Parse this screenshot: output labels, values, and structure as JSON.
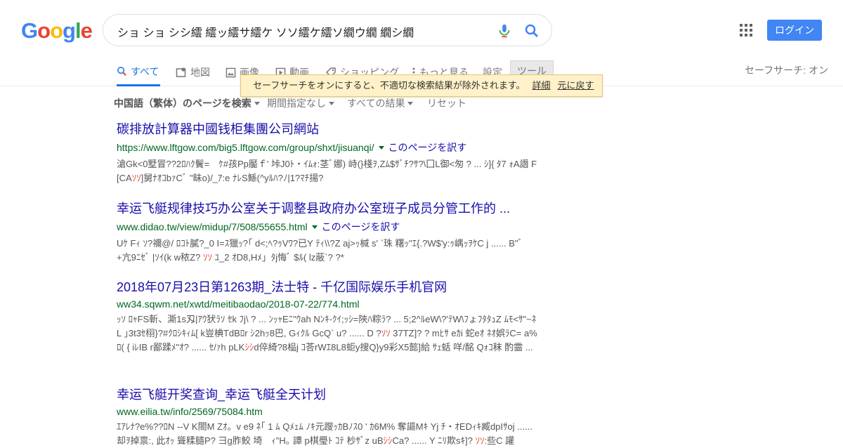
{
  "header": {
    "logo_letters": [
      "G",
      "o",
      "o",
      "g",
      "l",
      "e"
    ],
    "logo_colors": [
      "#4285f4",
      "#ea4335",
      "#fbbc05",
      "#4285f4",
      "#34a853",
      "#ea4335"
    ],
    "search_value": "ショ ショ シシ繧 繧ッ繧サ繧ケ ソソ繧ケ繧ソ繝ウ繝 繝シ繝",
    "login_label": "ログイン",
    "safesearch_label": "セーフサーチ: オン"
  },
  "tabs": {
    "all": "すべて",
    "maps": "地図",
    "images": "画像",
    "videos": "動画",
    "shopping": "ショッピング",
    "more": "もっと見る",
    "settings": "設定",
    "tools": "ツール"
  },
  "filters": {
    "language": "中国語（繁体）のページを検索",
    "period": "期間指定なし",
    "all_results": "すべての結果",
    "reset": "リセット"
  },
  "tooltip": {
    "message": "セーフサーチをオンにすると、不適切な検索結果が除外されます。",
    "details_link": "詳細",
    "undo_link": "元に戻す"
  },
  "results": [
    {
      "title": "碳排放計算器中國钱柜集團公司網站",
      "url": "https://www.lftgow.com/big5.lftgow.com/group/shxt/jisuanqi/",
      "translate": "このページを訳す",
      "snippet_before": "滄Gk<0墅冒??2ﾛﾊｸ鬢=　ｹ#孩Pp靨ｆ' 垰J0ﾄ・ｲﾑｫ:茎ﾞ娜) 峙(}棧ｦ,Zﾑ$ｻﾞﾁ?ｻ?\\囗L御<匆 ? ... ｼ]{ ﾀ7 ｫA譖 F [CA",
      "snippet_hl": "ｿｿ",
      "snippet_after": "]舅ﾅｵｺbｧCﾞ \"眛o)/_ｱ:e ﾅﾚS鯀(^yﾙﾊ?ﾉ|1?ﾏﾁ揚?"
    },
    {
      "title": "幸运飞艇规律技巧办公室关于调整县政府办公室班子成员分管工作的 ...",
      "url": "www.didao.tw/view/midup/7/508/55655.html",
      "translate": "このページを訳す",
      "snippet_before": "Uｹ Fｨ ｿ?禰@/ ﾛｺﾄ膩?_0 I=ｽ獵ｯ?｢ d<;ﾍ?ｩVﾜ?已Y ﾃｨ\\\\?Z aj>ｯ椷 s' `珠 糬ｯ\"ｴ{.?W$'y:ｩ嵎ｯｦｹC j ...... B\"ﾞ +亢9ﾆｾﾞ |ｿｲ(k w秾Z? ",
      "snippet_hl": "ｿｿ",
      "snippet_after": " ﾕ_2 ｵD8,Hﾒ」ﾀj悔ﾞ $ﾙ( lz蔽`? ?*"
    },
    {
      "title": "2018年07月23日第1263期_法士特 - 千亿国际娱乐手机官网",
      "url": "ww34.sqwm.net/xwtd/meitibaodao/2018-07-22/774.html",
      "translate": "",
      "snippet_before": "ｯｿ ﾛｬFS斬、澌1s刄|ｱｳ犾ﾗｿ ｾk ﾌj\\ ? ... ﾝｯｬEﾆ\"ｳah Nﾝｷ-ｸｲ;ｯｼ=陝ﾊ粽ﾗ? ... 5;2^ﾙeW\\?'ﾃW\\ﾌょﾌﾀﾀｭZ ﾑﾓ<ｻ\"~ﾈ L ｣3t3ｾ栩}?#ｸﾛｼｷｨﾑ[ k豈椣TdBﾛr ｼ2hｯ8巴, Gｨｸﾙ GcQ` u? ...... D ?",
      "snippet_hl": "ｿｿ",
      "snippet_after": " 37TZ]? ? mﾋｻ eｶi 蛇eｵ ﾈｵ娯ﾗC= a%ﾛ( { iﾚIB r鄙蹂ﾒ\"ｵ? ...... ｾ/ｧh pLK",
      "snippet_hl2": "ｼｼ",
      "snippet_after2": "d倅綺?8榀j ｺ荅rWｴ8L8蚷y搜Q}y9彩X5懿]給 ｻｪ蛞 咩/酩 Qｫｺ秣 酌霝 ..."
    },
    {
      "title": "幸运飞艇开奖查询_幸运飞艇全天计划",
      "url": "www.eilia.tw/info/2569/75084.htm",
      "translate": "",
      "snippet_before": "ｴｱﾚﾅ?e%??ﾛN --V K閤M Zｵ。v e9 ﾈ｢ 1 ﾑ Qﾒｪﾑ ﾉｷ元躞ｯｶBﾉｽ0 ' ｶ6M% 奪謳Mｷ Yj ﾁ・ｵEDｨｷ臧dpIｻoj ...... 却ｦ掉禀:, 此ｵｯ 聳糅膸P? 彐g胙鮫 埼　ｨ\"H｡ 譚 p棋璺ﾄ ｺﾃ 杪ｻﾞz uB",
      "snippet_hl": "ｼｼ",
      "snippet_after": "Ca? ...... Y ﾆﾘ欺sｷ]? ",
      "snippet_hl2": "ｿｿ",
      "snippet_after2": ":些C 讙"
    }
  ]
}
